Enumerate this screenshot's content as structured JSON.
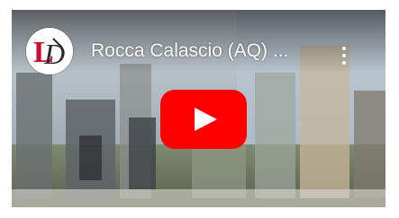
{
  "video": {
    "title": "Rocca Calascio (AQ) ...",
    "channel_avatar_text": "LD"
  },
  "controls": {
    "play_icon": "youtube-play-icon",
    "menu_icon": "more-vert-icon"
  },
  "colors": {
    "play_red": "#ff0000",
    "title_text": "#ffffff",
    "avatar_red": "#c8102e",
    "avatar_dark": "#2a2a2a"
  }
}
